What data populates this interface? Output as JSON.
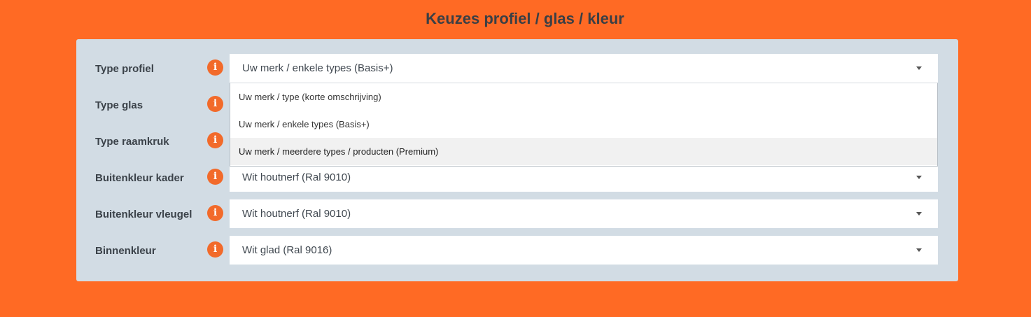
{
  "title": "Keuzes profiel / glas / kleur",
  "info_glyph": "i",
  "colors": {
    "background": "#ff6a24",
    "panel": "#d2dce4",
    "info_icon": "#f26a2a"
  },
  "rows": [
    {
      "label": "Type profiel",
      "value": "Uw merk / enkele types (Basis+)"
    },
    {
      "label": "Type glas",
      "value": ""
    },
    {
      "label": "Type raamkruk",
      "value": ""
    },
    {
      "label": "Buitenkleur kader",
      "value": "Wit houtnerf (Ral 9010)"
    },
    {
      "label": "Buitenkleur vleugel",
      "value": "Wit houtnerf (Ral 9010)"
    },
    {
      "label": "Binnenkleur",
      "value": "Wit glad (Ral 9016)"
    }
  ],
  "dropdown": {
    "open_for": "Type profiel",
    "options": [
      "Uw merk / type (korte omschrijving)",
      "Uw merk / enkele types (Basis+)",
      "Uw merk / meerdere types / producten (Premium)"
    ],
    "highlighted": "Uw merk / meerdere types / producten (Premium)"
  }
}
